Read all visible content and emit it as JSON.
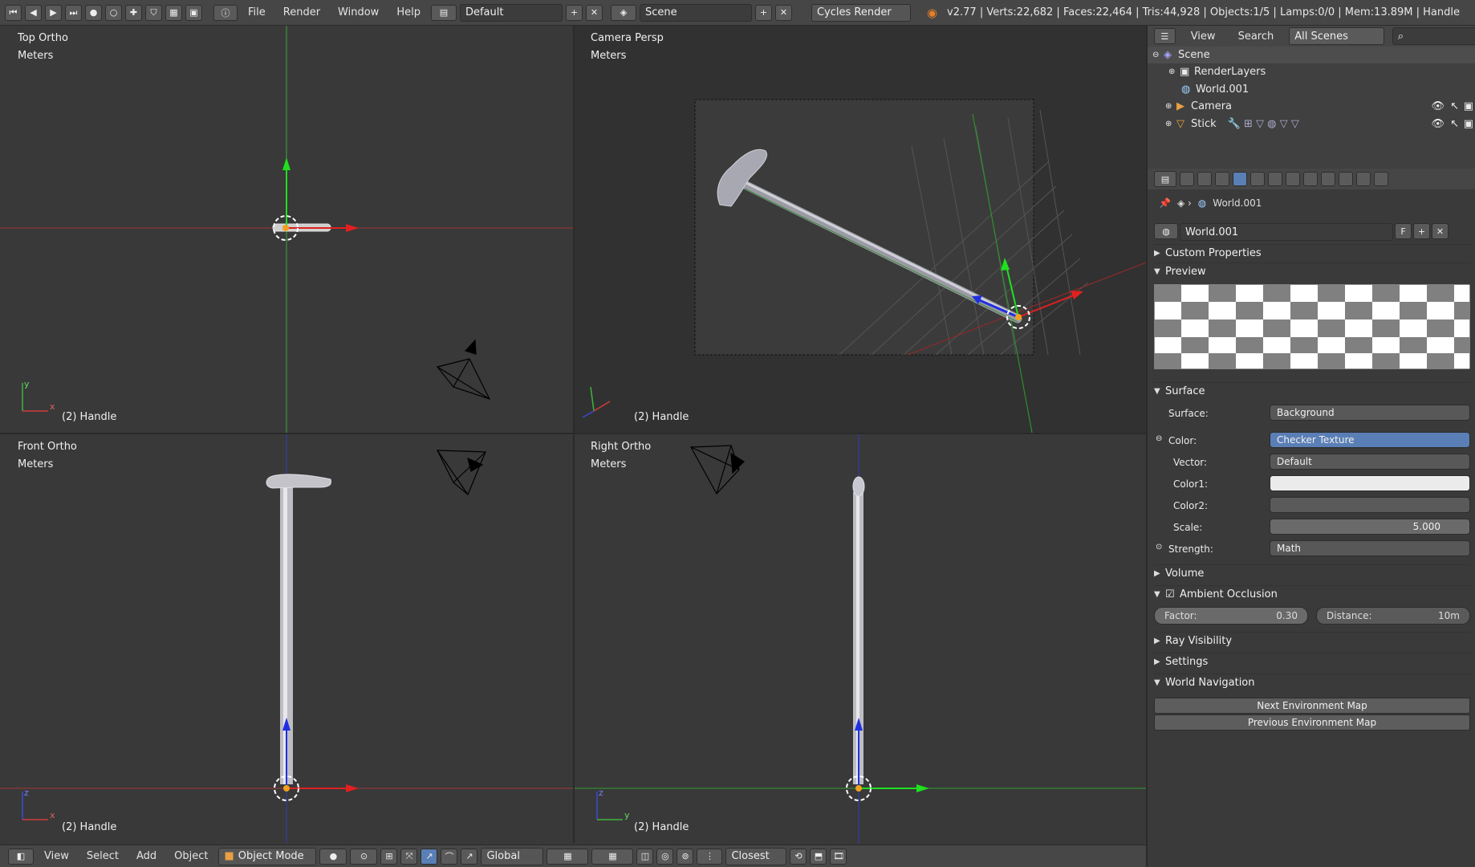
{
  "topbar": {
    "menus": [
      "File",
      "Render",
      "Window",
      "Help"
    ],
    "screen_layout": "Default",
    "scene": "Scene",
    "engine": "Cycles Render",
    "stats": "v2.77 | Verts:22,682 | Faces:22,464 | Tris:44,928 | Objects:1/5 | Lamps:0/0 | Mem:13.89M | Handle"
  },
  "viewports": {
    "top": {
      "title": "Top Ortho",
      "units": "Meters",
      "object": "(2) Handle",
      "axis_a": "y",
      "axis_b": "x"
    },
    "camera": {
      "title": "Camera Persp",
      "units": "Meters",
      "object": "(2) Handle"
    },
    "front": {
      "title": "Front Ortho",
      "units": "Meters",
      "object": "(2) Handle",
      "axis_a": "z",
      "axis_b": "x"
    },
    "right": {
      "title": "Right Ortho",
      "units": "Meters",
      "object": "(2) Handle",
      "axis_a": "z",
      "axis_b": "y"
    }
  },
  "bottombar": {
    "menus": [
      "View",
      "Select",
      "Add",
      "Object"
    ],
    "mode": "Object Mode",
    "orientation": "Global",
    "snap": "Closest"
  },
  "outliner": {
    "menus": [
      "View",
      "Search"
    ],
    "filter": "All Scenes",
    "rows": [
      "Scene",
      "RenderLayers",
      "World.001",
      "Camera",
      "Stick"
    ]
  },
  "properties": {
    "breadcrumb": "World.001",
    "datablock": "World.001",
    "fake_user": "F",
    "panels": {
      "custom_properties": "Custom Properties",
      "preview": "Preview",
      "surface": "Surface",
      "volume": "Volume",
      "ao": "Ambient Occlusion",
      "ray_visibility": "Ray Visibility",
      "settings": "Settings",
      "world_nav": "World Navigation"
    },
    "surface": {
      "surface_label": "Surface:",
      "surface_value": "Background",
      "color_label": "Color:",
      "color_value": "Checker Texture",
      "vector_label": "Vector:",
      "vector_value": "Default",
      "color1_label": "Color1:",
      "color2_label": "Color2:",
      "scale_label": "Scale:",
      "scale_value": "5.000",
      "strength_label": "Strength:",
      "strength_value": "Math"
    },
    "ao": {
      "factor_label": "Factor:",
      "factor_value": "0.30",
      "distance_label": "Distance:",
      "distance_value": "10m"
    },
    "buttons": {
      "next": "Next Environment Map",
      "prev": "Previous Environment Map"
    }
  },
  "colors": {
    "accent": "#5a7fb6",
    "x_axis": "#d11c1c",
    "y_axis": "#1cc81c",
    "z_axis": "#2030e0"
  }
}
